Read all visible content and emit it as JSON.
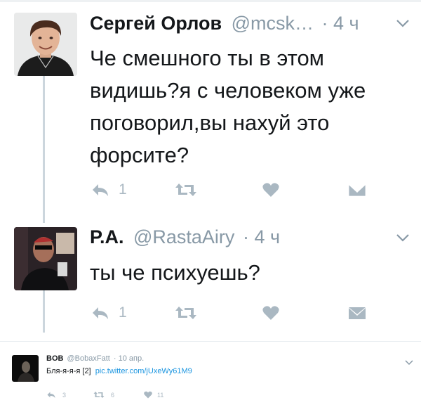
{
  "tweets": [
    {
      "name": "Сергей Орлов",
      "handle": "@mcsk…",
      "dot": "·",
      "time": "4 ч",
      "lines": [
        "Че смешного ты в этом",
        "видишь?я с человеком уже",
        "поговорил,вы нахуй это",
        "форсите?"
      ],
      "reply_count": "1",
      "avatar_icon": "person-photo"
    },
    {
      "name": "Р.А.",
      "handle": "@RastaAiry",
      "dot": "·",
      "time": "4 ч",
      "lines": [
        "ты че психуешь?"
      ],
      "reply_count": "1",
      "avatar_icon": "person-photo"
    }
  ],
  "quoted": {
    "name": "BOB",
    "handle": "@BobaxFatt",
    "dot": "·",
    "time": "10 апр.",
    "text": "Бля-я-я-я [2]",
    "link": "pic.twitter.com/jUxeWy61M9",
    "reply_count": "3",
    "retweet_count": "6",
    "like_count": "11"
  },
  "colors": {
    "icon_gray": "#aab8c2",
    "meta_gray": "#8899a6",
    "link_blue": "#1b95e0",
    "thread_line": "#ccd6dd"
  }
}
